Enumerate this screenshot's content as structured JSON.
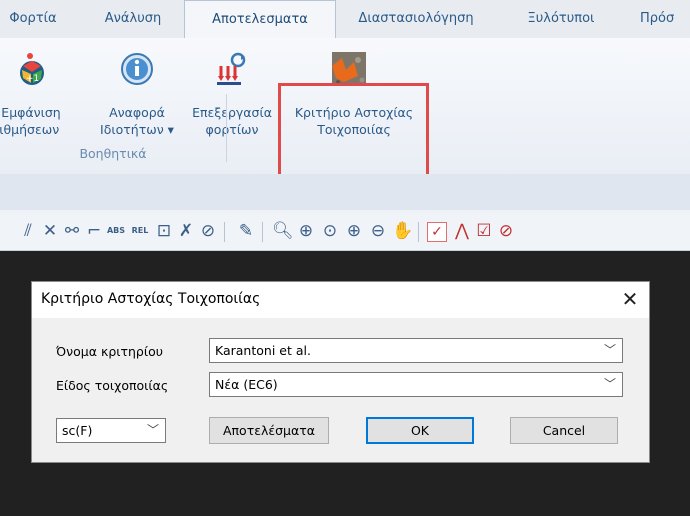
{
  "tabs": [
    {
      "label": "Φορτία"
    },
    {
      "label": "Ανάλυση"
    },
    {
      "label": "Αποτελεσματα"
    },
    {
      "label": "Διαστασιολόγηση"
    },
    {
      "label": "Ξυλότυποι"
    },
    {
      "label": "Πρόσ"
    }
  ],
  "active_tab": "Αποτελεσματα",
  "ribbon": {
    "buttons": [
      {
        "line1": "Εμφάνιση",
        "line2": "Αριθμήσεων",
        "icon": "display-numbering-icon"
      },
      {
        "line1": "Αναφορά",
        "line2": "Ιδιοτήτων ▾",
        "icon": "info-icon"
      },
      {
        "line1": "Επεξεργασία",
        "line2": "φορτίων",
        "icon": "load-editing-icon"
      },
      {
        "line1": "Κριτήριο Αστοχίας",
        "line2": "Τοιχοποιίας",
        "icon": "masonry-failure-criterion-icon"
      }
    ],
    "group_label": "Βοηθητικά",
    "highlight_color": "#e14a4a"
  },
  "dialog": {
    "title": "Κριτήριο Αστοχίας Τοιχοποιίας",
    "criterion_label": "Όνομα κριτηρίου",
    "criterion_value": "Karantoni et al.",
    "masonry_label": "Είδος τοιχοποιίας",
    "masonry_value": "Νέα (EC6)",
    "plot_value": "sc(F)",
    "results_button": "Αποτελέσματα",
    "ok_button": "OK",
    "cancel_button": "Cancel"
  }
}
